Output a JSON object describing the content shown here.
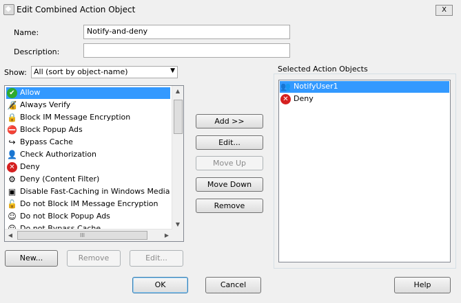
{
  "window": {
    "title": "Edit Combined Action Object",
    "close_glyph": "X"
  },
  "form": {
    "name_label": "Name:",
    "name_value": "Notify-and-deny",
    "description_label": "Description:",
    "description_value": "",
    "show_label": "Show:",
    "show_value": "All (sort by object-name)"
  },
  "available_list": {
    "items": [
      {
        "label": "Allow",
        "icon": "allow-check-icon",
        "selected": true
      },
      {
        "label": "Always Verify",
        "icon": "verify-icon"
      },
      {
        "label": "Block IM Message Encryption",
        "icon": "im-block-icon"
      },
      {
        "label": "Block Popup Ads",
        "icon": "popup-block-icon"
      },
      {
        "label": "Bypass Cache",
        "icon": "bypass-cache-icon"
      },
      {
        "label": "Check Authorization",
        "icon": "authorization-icon"
      },
      {
        "label": "Deny",
        "icon": "deny-icon"
      },
      {
        "label": "Deny (Content Filter)",
        "icon": "content-filter-icon"
      },
      {
        "label": "Disable Fast-Caching in Windows Media Client",
        "icon": "media-client-icon"
      },
      {
        "label": "Do not Block IM Message Encryption",
        "icon": "im-icon"
      },
      {
        "label": "Do not Block Popup Ads",
        "icon": "popup-icon"
      },
      {
        "label": "Do not Bypass Cache",
        "icon": "cache-icon"
      }
    ],
    "hscroll_grip": "III"
  },
  "middle_buttons": {
    "add": "Add >>",
    "edit": "Edit...",
    "move_up": "Move Up",
    "move_down": "Move Down",
    "remove": "Remove"
  },
  "bottom_left_buttons": {
    "new": "New...",
    "remove": "Remove",
    "edit": "Edit..."
  },
  "selected_group": {
    "label": "Selected Action Objects",
    "items": [
      {
        "label": "NotifyUser1",
        "icon": "notify-user-icon",
        "selected": true
      },
      {
        "label": "Deny",
        "icon": "deny-icon"
      }
    ]
  },
  "dialog_buttons": {
    "ok": "OK",
    "cancel": "Cancel",
    "help": "Help"
  }
}
